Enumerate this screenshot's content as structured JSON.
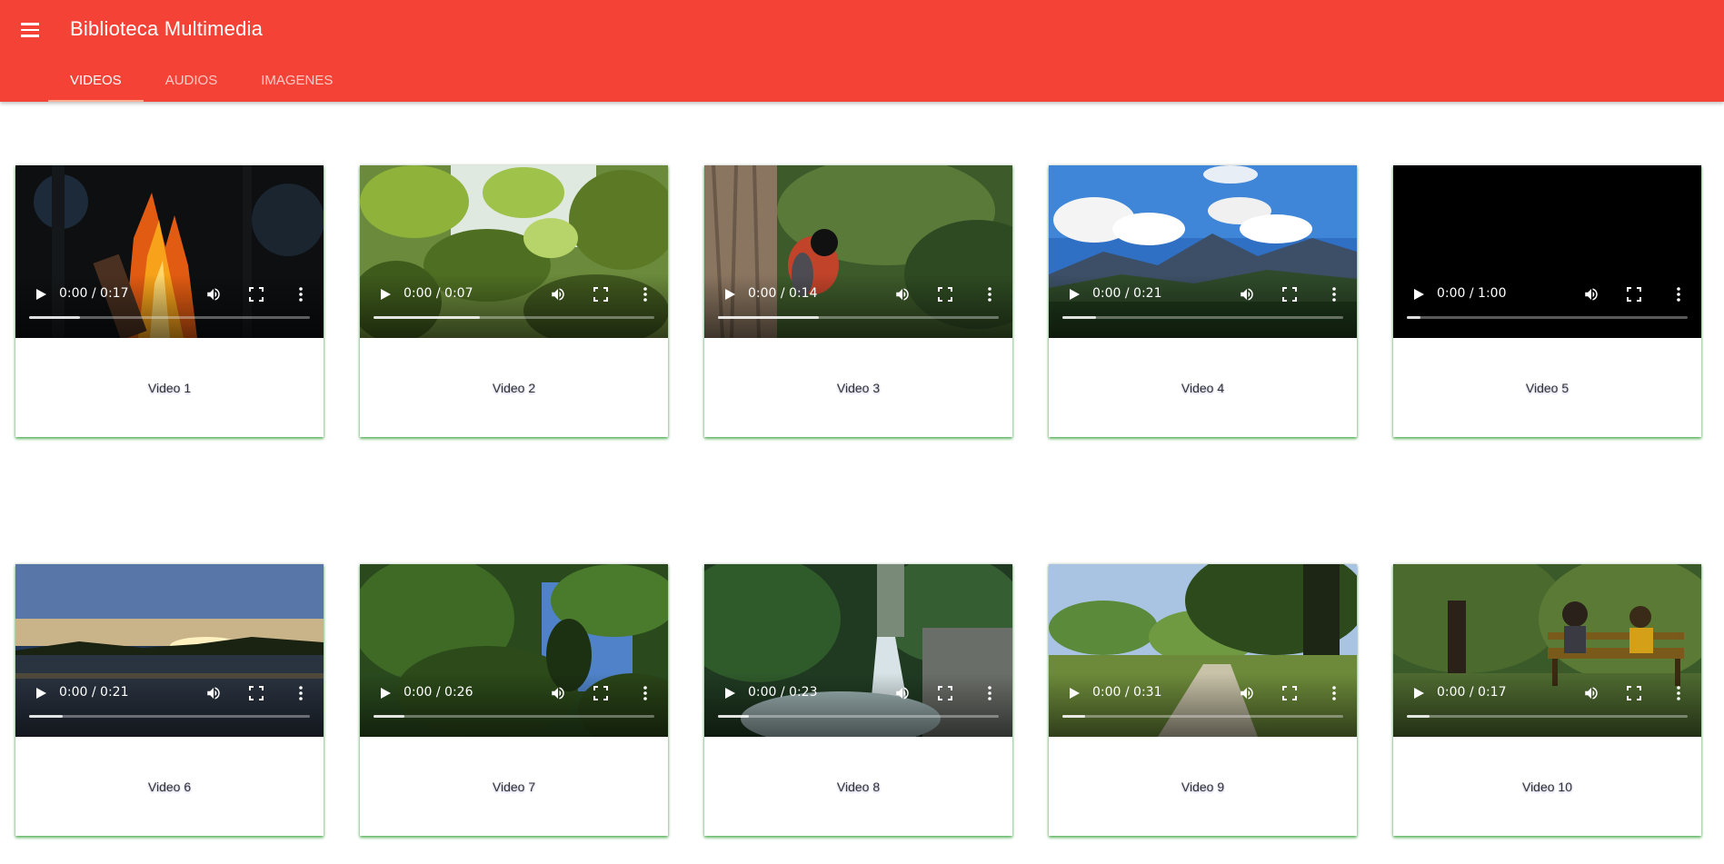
{
  "app": {
    "title": "Biblioteca Multimedia"
  },
  "colors": {
    "appbar": "#f44336",
    "tab_indicator": "#ffab91",
    "card_shadow": "#4caf50"
  },
  "icons": {
    "menu": "menu-icon",
    "play": "play-icon",
    "volume": "volume-icon",
    "fullscreen": "fullscreen-icon",
    "more": "more-vert-icon"
  },
  "tabs": [
    {
      "label": "VIDEOS",
      "active": true
    },
    {
      "label": "AUDIOS",
      "active": false
    },
    {
      "label": "IMAGENES",
      "active": false
    }
  ],
  "videos": [
    {
      "title": "Video 1",
      "time": "0:00 / 0:17",
      "progress": 0.18
    },
    {
      "title": "Video 2",
      "time": "0:00 / 0:07",
      "progress": 0.38
    },
    {
      "title": "Video 3",
      "time": "0:00 / 0:14",
      "progress": 0.36
    },
    {
      "title": "Video 4",
      "time": "0:00 / 0:21",
      "progress": 0.12
    },
    {
      "title": "Video 5",
      "time": "0:00 / 1:00",
      "progress": 0.05
    },
    {
      "title": "Video 6",
      "time": "0:00 / 0:21",
      "progress": 0.12
    },
    {
      "title": "Video 7",
      "time": "0:00 / 0:26",
      "progress": 0.11
    },
    {
      "title": "Video 8",
      "time": "0:00 / 0:23",
      "progress": 0.11
    },
    {
      "title": "Video 9",
      "time": "0:00 / 0:31",
      "progress": 0.08
    },
    {
      "title": "Video 10",
      "time": "0:00 / 0:17",
      "progress": 0.08
    }
  ]
}
